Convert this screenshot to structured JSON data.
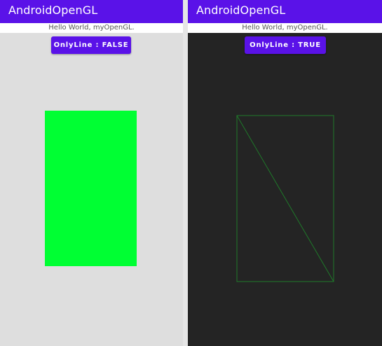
{
  "colors": {
    "appbar": "#5a12e8",
    "button": "#5a12e8",
    "surface_light": "#dedede",
    "surface_dark": "#242424",
    "fill_green": "#00ff33",
    "line_green": "#1f7a2a"
  },
  "left_screen": {
    "app_title": "AndroidOpenGL",
    "hello_text": "Hello World, myOpenGL.",
    "toggle_label": "OnlyLine : FALSE",
    "only_line": false
  },
  "right_screen": {
    "app_title": "AndroidOpenGL",
    "hello_text": "Hello World, myOpenGL.",
    "toggle_label": "OnlyLine : TRUE",
    "only_line": true
  }
}
